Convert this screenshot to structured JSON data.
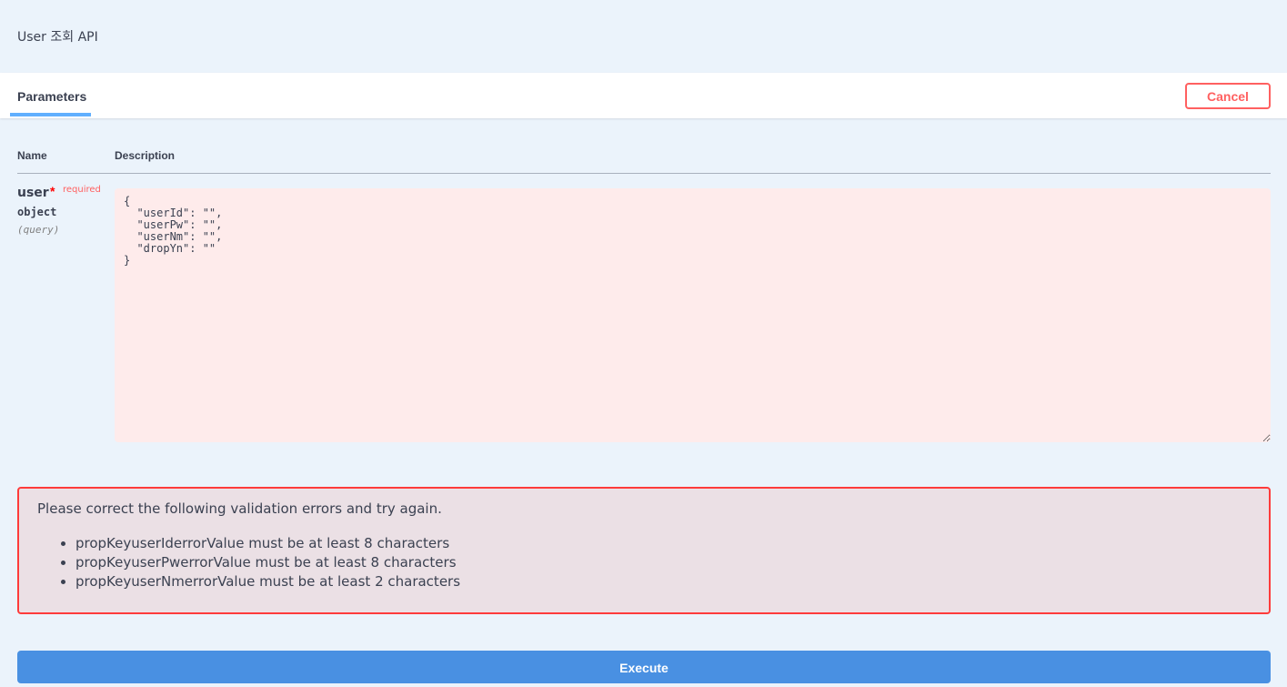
{
  "summary": {
    "description": "User 조회 API"
  },
  "header": {
    "tab_label": "Parameters",
    "cancel_label": "Cancel"
  },
  "columns": {
    "name": "Name",
    "description": "Description"
  },
  "parameter": {
    "name": "user",
    "required_star": "*",
    "required_label": "required",
    "type": "object",
    "location": "(query)",
    "value": "{\n  \"userId\": \"\",\n  \"userPw\": \"\",\n  \"userNm\": \"\",\n  \"dropYn\": \"\"\n}"
  },
  "validation": {
    "title": "Please correct the following validation errors and try again.",
    "errors": [
      "propKeyuserIderrorValue must be at least 8 characters",
      "propKeyuserPwerrorValue must be at least 8 characters",
      "propKeyuserNmerrorValue must be at least 2 characters"
    ]
  },
  "actions": {
    "execute_label": "Execute"
  },
  "colors": {
    "page_background": "#ebf3fb",
    "tab_underline": "#61affe",
    "cancel": "#ff6060",
    "error_border": "#ff3b3b",
    "error_background": "#ebe0e5",
    "input_invalid_background": "#feebeb",
    "execute": "#4990e2"
  }
}
